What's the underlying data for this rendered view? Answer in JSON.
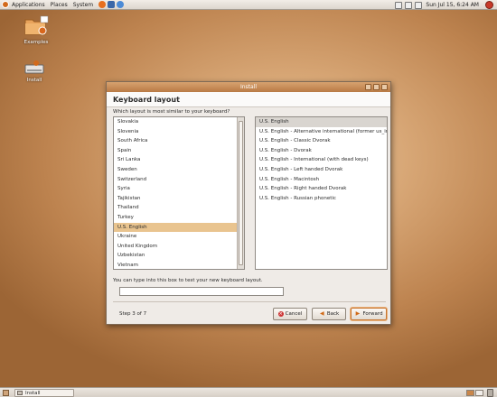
{
  "top_panel": {
    "menus": [
      "Applications",
      "Places",
      "System"
    ],
    "clock": "Sun Jul 15,  6:24 AM"
  },
  "desktop_icons": [
    {
      "label": "Examples"
    },
    {
      "label": "Install"
    }
  ],
  "window": {
    "title": "Install",
    "heading": "Keyboard layout",
    "question": "Which layout is most similar to your keyboard?",
    "layouts": [
      "Slovakia",
      "Slovenia",
      "South Africa",
      "Spain",
      "Sri Lanka",
      "Sweden",
      "Switzerland",
      "Syria",
      "Tajikistan",
      "Thailand",
      "Turkey",
      "U.S. English",
      "Ukraine",
      "United Kingdom",
      "Uzbekistan",
      "Vietnam"
    ],
    "selected_layout": "U.S. English",
    "variants": [
      "U.S. English",
      "U.S. English - Alternative international (former us_int",
      "U.S. English - Classic Dvorak",
      "U.S. English - Dvorak",
      "U.S. English - International (with dead keys)",
      "U.S. English - Left handed Dvorak",
      "U.S. English - Macintosh",
      "U.S. English - Right handed Dvorak",
      "U.S. English - Russian phonetic"
    ],
    "selected_variant": "U.S. English",
    "test_label": "You can type into this box to test your new keyboard layout.",
    "test_value": "",
    "step": "Step 3 of 7",
    "buttons": {
      "cancel": "Cancel",
      "back": "Back",
      "forward": "Forward"
    }
  },
  "bottom_panel": {
    "task": "Install"
  },
  "colors": {
    "selection": "#e9c48f",
    "titlebar": "#c88a52",
    "accent": "#d06a17"
  }
}
